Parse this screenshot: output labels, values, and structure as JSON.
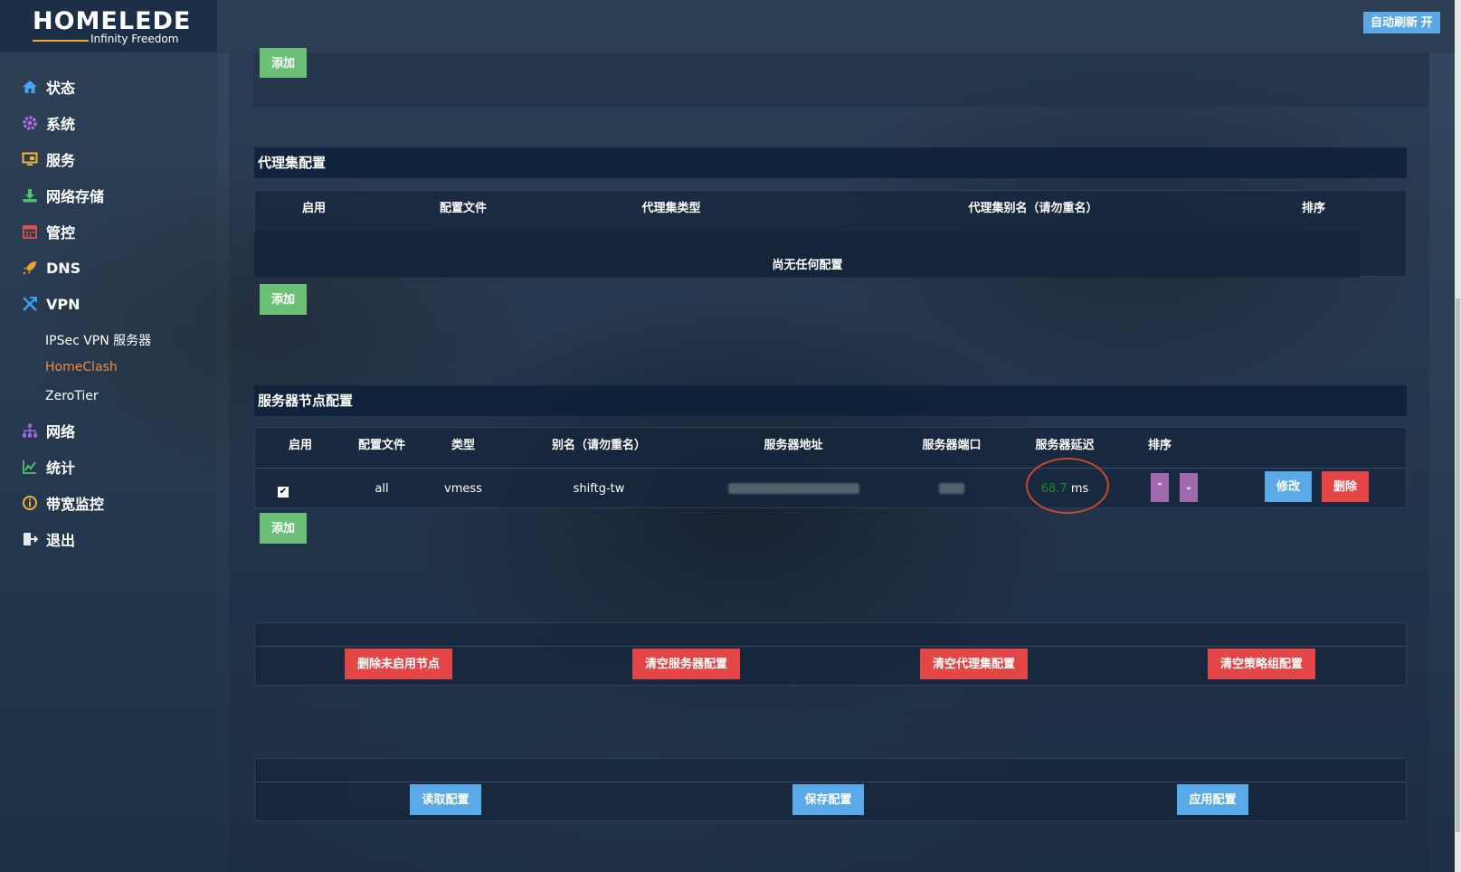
{
  "brand": {
    "name": "HOMELEDE",
    "slogan": "Infinity Freedom"
  },
  "header": {
    "auto_refresh": "自动刷新 开"
  },
  "sidebar": {
    "items": [
      {
        "label": "状态",
        "icon": "home-icon",
        "color": "#4aa3f0"
      },
      {
        "label": "系统",
        "icon": "gear-icon",
        "color": "#b56ae8"
      },
      {
        "label": "服务",
        "icon": "monitor-icon",
        "color": "#f0b33c"
      },
      {
        "label": "网络存储",
        "icon": "download-icon",
        "color": "#4bc46e"
      },
      {
        "label": "管控",
        "icon": "calendar-icon",
        "color": "#e05050"
      },
      {
        "label": "DNS",
        "icon": "rocket-icon",
        "color": "#f0a030"
      },
      {
        "label": "VPN",
        "icon": "vpn-icon",
        "color": "#3aa0f0"
      },
      {
        "label": "网络",
        "icon": "network-icon",
        "color": "#9a6ae0"
      },
      {
        "label": "统计",
        "icon": "chart-icon",
        "color": "#4bc46e"
      },
      {
        "label": "带宽监控",
        "icon": "info-icon",
        "color": "#f0b33c"
      },
      {
        "label": "退出",
        "icon": "logout-icon",
        "color": "#e8e8e8"
      }
    ],
    "vpn_sub": [
      "IPSec VPN 服务器",
      "HomeClash",
      "ZeroTier"
    ]
  },
  "common": {
    "add_label": "添加"
  },
  "proxy_provider": {
    "title": "代理集配置",
    "headers": [
      "启用",
      "配置文件",
      "代理集类型",
      "代理集别名（请勿重名）",
      "排序"
    ],
    "empty_text": "尚无任何配置"
  },
  "servers": {
    "title": "服务器节点配置",
    "headers": [
      "启用",
      "配置文件",
      "类型",
      "别名（请勿重名）",
      "服务器地址",
      "服务器端口",
      "服务器延迟",
      "排序"
    ],
    "rows": [
      {
        "enabled": true,
        "config": "all",
        "type": "vmess",
        "alias": "shiftg-tw",
        "latency_value": "68.7",
        "latency_unit": "ms",
        "edit": "修改",
        "delete": "删除"
      }
    ]
  },
  "actions": {
    "delete_disabled": "删除未启用节点",
    "clear_servers": "清空服务器配置",
    "clear_proxy": "清空代理集配置",
    "clear_policy": "清空策略组配置",
    "read": "读取配置",
    "save": "保存配置",
    "apply": "应用配置"
  }
}
